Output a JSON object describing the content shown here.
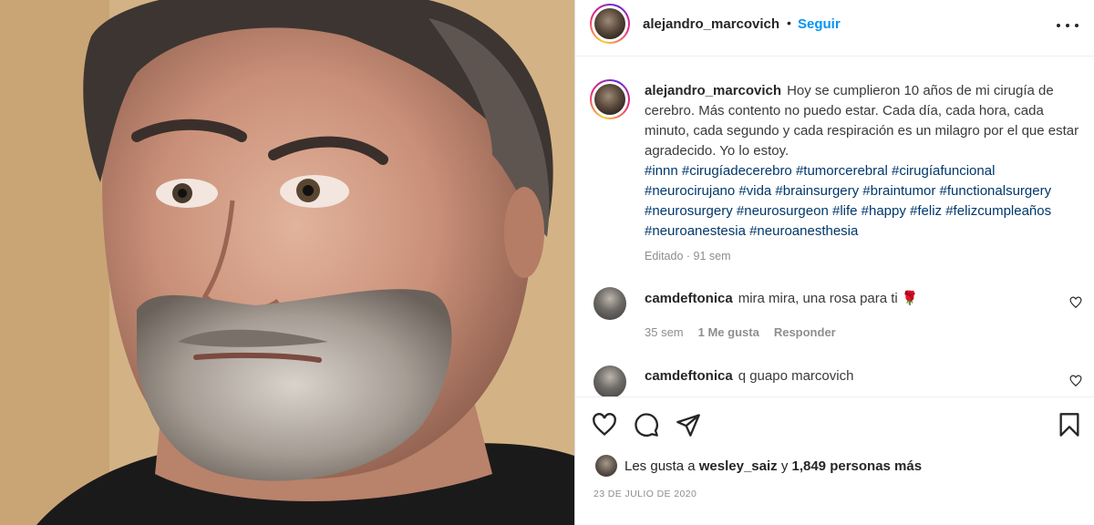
{
  "post": {
    "username": "alejandro_marcovich",
    "dot": "•",
    "follow_label": "Seguir",
    "more_icon": "more-horizontal-icon"
  },
  "caption": {
    "username": "alejandro_marcovich",
    "text": "Hoy se cumplieron 10 años de mi cirugía de cerebro. Más contento no puedo estar. Cada día, cada hora, cada minuto, cada segundo y cada respiración es un milagro por el que estar agradecido. Yo lo estoy.",
    "hashtags": "#innn #cirugíadecerebro #tumorcerebral #cirugíafuncional #neurocirujano #vida #brainsurgery #braintumor #functionalsurgery #neurosurgery #neurosurgeon #life #happy #feliz #felizcumpleaños #neuroanestesia #neuroanesthesia",
    "edited": "Editado · 91 sem"
  },
  "comments": [
    {
      "username": "camdeftonica",
      "text": "mira mira, una rosa para ti 🌹",
      "time": "35 sem",
      "likes": "1 Me gusta",
      "reply": "Responder"
    },
    {
      "username": "camdeftonica",
      "text": "q guapo marcovich"
    }
  ],
  "actions": {
    "like_icon": "heart-icon",
    "comment_icon": "comment-icon",
    "share_icon": "share-icon",
    "save_icon": "bookmark-icon"
  },
  "likes": {
    "prefix": "Les gusta a",
    "user": "wesley_saiz",
    "conj": "y",
    "others": "1,849 personas más"
  },
  "date": "23 DE JULIO DE 2020"
}
